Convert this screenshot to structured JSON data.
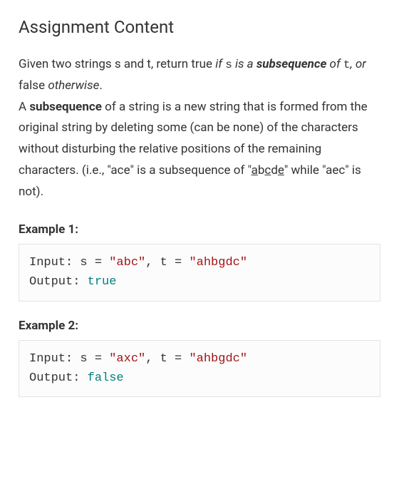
{
  "title": "Assignment Content",
  "desc": {
    "p1_a": "Given two strings s and t, return true ",
    "p1_b": "if ",
    "p1_c": "s",
    "p1_d": " is a ",
    "p1_e": "subsequence",
    "p1_f": " of ",
    "p1_g": "t",
    "p1_h": ", or ",
    "p1_i": "false",
    "p1_j": " ",
    "p1_k": "otherwise",
    "p1_l": ".",
    "p2_a": "A ",
    "p2_b": "subsequence",
    "p2_c": " of a string is a new string that is formed from the original string by deleting some (can be none) of the characters without disturbing the relative positions of the remaining characters. (i.e., \"ace\" is a subsequence of \"",
    "p2_u1": "a",
    "p2_m1": "b",
    "p2_u2": "c",
    "p2_m2": "d",
    "p2_u3": "e",
    "p2_d": "\" while \"aec\" is not)."
  },
  "example1": {
    "label": "Example 1:",
    "input_prefix": "Input: s = ",
    "s_val": "\"abc\"",
    "sep": ", t = ",
    "t_val": "\"ahbgdc\"",
    "output_prefix": "Output: ",
    "output_val": "true"
  },
  "example2": {
    "label": "Example 2:",
    "input_prefix": "Input: s = ",
    "s_val": "\"axc\"",
    "sep": ", t = ",
    "t_val": "\"ahbgdc\"",
    "output_prefix": "Output: ",
    "output_val": "false"
  }
}
